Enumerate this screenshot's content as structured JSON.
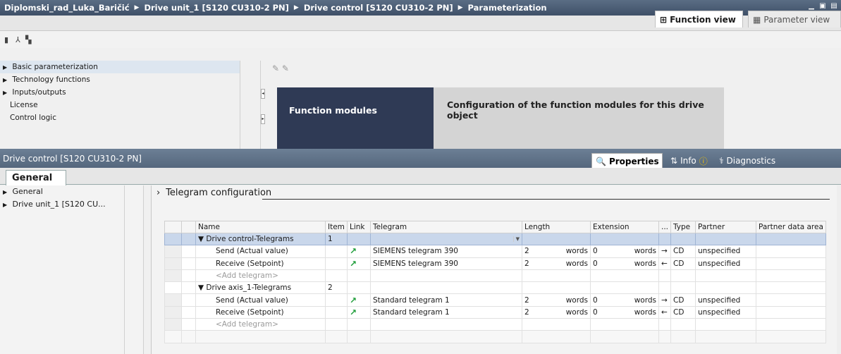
{
  "breadcrumb": [
    "Diplomski_rad_Luka_Baričić",
    "Drive unit_1 [S120 CU310-2 PN]",
    "Drive control [S120 CU310-2 PN]",
    "Parameterization"
  ],
  "view_tabs": {
    "function_view": "Function view",
    "parameter_view": "Parameter view"
  },
  "nav": [
    {
      "label": "Basic parameterization",
      "arrow": "▶"
    },
    {
      "label": "Technology functions",
      "arrow": "▶"
    },
    {
      "label": "Inputs/outputs",
      "arrow": "▶"
    },
    {
      "label": "License",
      "arrow": ""
    },
    {
      "label": "Control logic",
      "arrow": ""
    }
  ],
  "function_card": {
    "title": "Function modules",
    "description": "Configuration of the function modules for this drive object"
  },
  "properties_panel": {
    "title": "Drive control [S120 CU310-2 PN]",
    "tabs": {
      "properties": "Properties",
      "info": "Info",
      "diagnostics": "Diagnostics"
    },
    "general_tab": "General",
    "left_nav": [
      {
        "label": "General",
        "arrow": "▶"
      },
      {
        "label": "Drive unit_1 [S120 CU...",
        "arrow": "▶"
      }
    ],
    "section_title": "Telegram configuration",
    "columns": [
      "Name",
      "Item",
      "Link",
      "Telegram",
      "Length",
      "Extension",
      "...",
      "Type",
      "Partner",
      "Partner data area"
    ],
    "rows": [
      {
        "kind": "group",
        "name": "Drive control-Telegrams",
        "item": "1",
        "link": "",
        "telegram": "",
        "len": "",
        "len_unit": "",
        "ext": "",
        "ext_unit": "",
        "dir": "",
        "type": "",
        "partner": "",
        "selected": true
      },
      {
        "kind": "row",
        "name": "Send (Actual value)",
        "item": "",
        "link": "↗",
        "telegram": "SIEMENS telegram 390",
        "len": "2",
        "len_unit": "words",
        "ext": "0",
        "ext_unit": "words",
        "dir": "→",
        "type": "CD",
        "partner": "unspecified"
      },
      {
        "kind": "row",
        "name": "Receive (Setpoint)",
        "item": "",
        "link": "↗",
        "telegram": "SIEMENS telegram 390",
        "len": "2",
        "len_unit": "words",
        "ext": "0",
        "ext_unit": "words",
        "dir": "←",
        "type": "CD",
        "partner": "unspecified"
      },
      {
        "kind": "add",
        "name": "<Add telegram>"
      },
      {
        "kind": "group",
        "name": "Drive axis_1-Telegrams",
        "item": "2",
        "link": "",
        "telegram": "",
        "len": "",
        "len_unit": "",
        "ext": "",
        "ext_unit": "",
        "dir": "",
        "type": "",
        "partner": ""
      },
      {
        "kind": "row",
        "name": "Send (Actual value)",
        "item": "",
        "link": "↗",
        "telegram": "Standard telegram 1",
        "len": "2",
        "len_unit": "words",
        "ext": "0",
        "ext_unit": "words",
        "dir": "→",
        "type": "CD",
        "partner": "unspecified"
      },
      {
        "kind": "row",
        "name": "Receive (Setpoint)",
        "item": "",
        "link": "↗",
        "telegram": "Standard telegram 1",
        "len": "2",
        "len_unit": "words",
        "ext": "0",
        "ext_unit": "words",
        "dir": "←",
        "type": "CD",
        "partner": "unspecified"
      },
      {
        "kind": "add",
        "name": "<Add telegram>"
      }
    ]
  },
  "colors": {
    "title_bg": "#4a5b72",
    "card_dark": "#2f3a55",
    "card_light": "#d4d4d4",
    "selection": "#c9d7eb",
    "link_green": "#1f9d3a"
  }
}
